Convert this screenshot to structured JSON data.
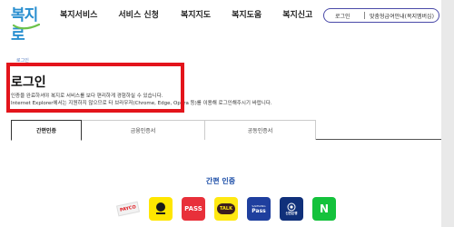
{
  "header": {
    "logo_text": "복지로",
    "nav": [
      "복지서비스",
      "서비스 신청",
      "복지지도",
      "복지도움",
      "복지신고"
    ],
    "login_label": "로그인",
    "vision_label": "맞춤형급여안내(복지멤버십)"
  },
  "breadcrumb": "로그인",
  "page_title": "로그인",
  "desc_line1": "인증을 완료하셔야 복지로 서비스를 보다 편리하게 경험하실 수 있습니다.",
  "desc_line2": "Internet Explorer에서는 지원하지 않으므로 타 브라우저(Chrome, Edge, Opera 등)를 이용해 로그인해주시기 바랍니다.",
  "tabs": [
    {
      "label": "간편인증",
      "active": true
    },
    {
      "label": "금융인증서",
      "active": false
    },
    {
      "label": "공동인증서",
      "active": false
    }
  ],
  "section_title": "간편 인증",
  "auth_methods": [
    {
      "name": "payco",
      "text": "PAYCO"
    },
    {
      "name": "kakaobank",
      "text": "kakao bank"
    },
    {
      "name": "pass",
      "text": "PASS"
    },
    {
      "name": "kakaotalk",
      "text": "TALK"
    },
    {
      "name": "samsungpass",
      "text": "Pass",
      "sub": "SAMSUNG"
    },
    {
      "name": "shinhan",
      "text": "신한은행"
    },
    {
      "name": "naver",
      "text": "N"
    }
  ],
  "colors": {
    "accent_blue": "#1e4fa8",
    "highlight_red": "#e3141b",
    "logo_blue": "#2a8fd0"
  }
}
